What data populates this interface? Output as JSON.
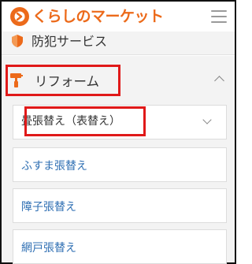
{
  "header": {
    "logo_text": "くらしのマーケット",
    "menu_icon": "hamburger-menu-icon"
  },
  "categories": {
    "partial": {
      "label": "防犯サービス",
      "icon": "shield-icon"
    },
    "expanded": {
      "label": "リフォーム",
      "icon": "paint-roller-icon",
      "state_icon": "chevron-up-icon"
    }
  },
  "subcategories": {
    "selected": {
      "label": "畳張替え（表替え）",
      "state_icon": "chevron-down-icon"
    },
    "items": [
      {
        "label": "ふすま張替え"
      },
      {
        "label": "障子張替え"
      },
      {
        "label": "網戸張替え"
      }
    ]
  },
  "colors": {
    "brand": "#ec6a1a",
    "link": "#2f6fb3",
    "highlight": "#e01919",
    "panel_bg": "#f3f3f3"
  }
}
